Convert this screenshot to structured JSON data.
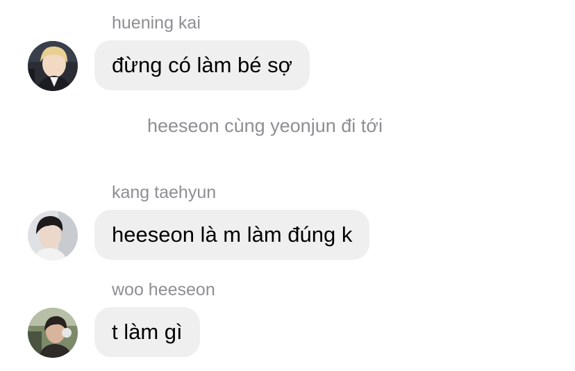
{
  "messages": [
    {
      "sender": "huening kai",
      "text": "đừng có làm bé sợ",
      "avatar_icon": "profile-photo-blond-hair-suit"
    },
    {
      "sender": "kang taehyun",
      "text": "heeseon là m làm đúng k",
      "avatar_icon": "profile-photo-dark-hair"
    },
    {
      "sender": "woo heeseon",
      "text": "t làm gì",
      "avatar_icon": "profile-photo-outdoor-headphones"
    }
  ],
  "event_text": "heeseon cùng yeonjun đi tới",
  "colors": {
    "background": "#ffffff",
    "bubble": "#efeff0",
    "secondary_text": "#8e8e93",
    "message_text": "#000000"
  }
}
